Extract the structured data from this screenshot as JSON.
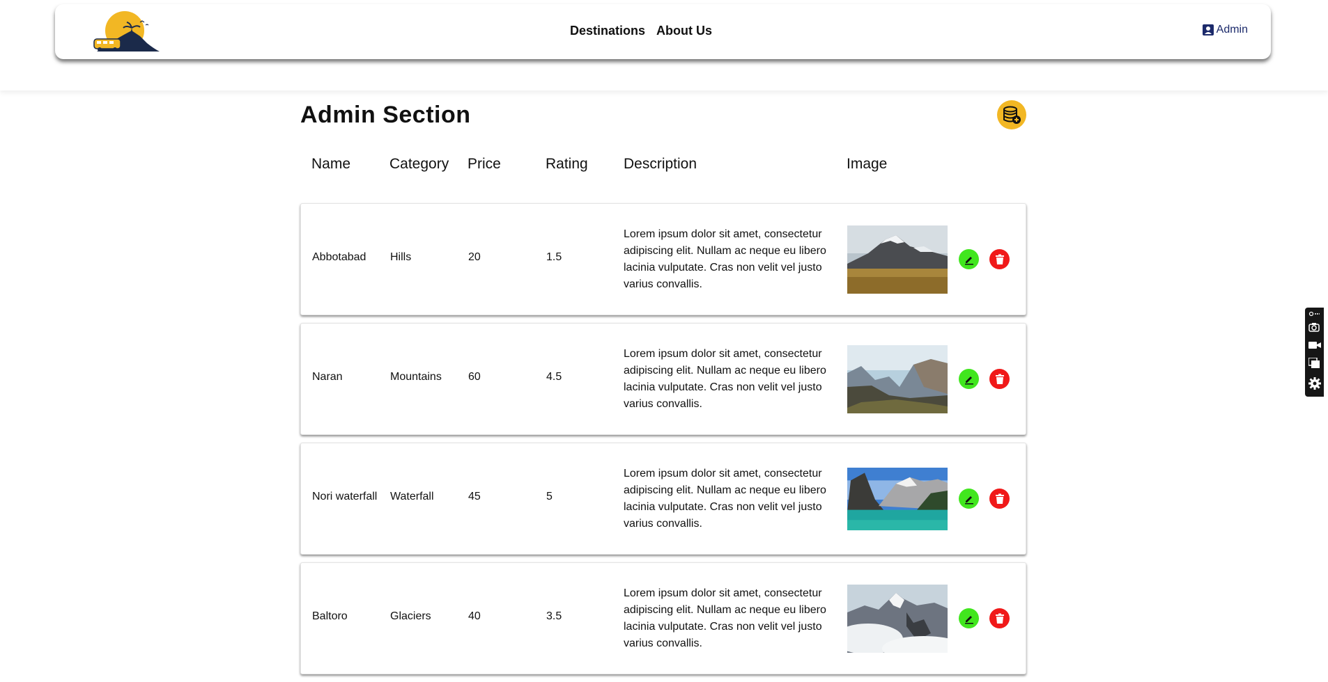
{
  "nav": {
    "links": [
      "Destinations",
      "About Us"
    ],
    "admin_label": "Admin"
  },
  "page": {
    "title": "Admin Section"
  },
  "table": {
    "headers": [
      "Name",
      "Category",
      "Price",
      "Rating",
      "Description",
      "Image"
    ],
    "rows": [
      {
        "name": "Abbotabad",
        "category": "Hills",
        "price": "20",
        "rating": "1.5",
        "description": "Lorem ipsum dolor sit amet, consectetur adipiscing elit. Nullam ac neque eu libero lacinia vulputate. Cras non velit vel justo varius convallis.",
        "image": "snowy-mountain-plain"
      },
      {
        "name": "Naran",
        "category": "Mountains",
        "price": "60",
        "rating": "4.5",
        "description": "Lorem ipsum dolor sit amet, consectetur adipiscing elit. Nullam ac neque eu libero lacinia vulputate. Cras non velit vel justo varius convallis.",
        "image": "mountain-valley"
      },
      {
        "name": "Nori waterfall",
        "category": "Waterfall",
        "price": "45",
        "rating": "5",
        "description": "Lorem ipsum dolor sit amet, consectetur adipiscing elit. Nullam ac neque eu libero lacinia vulputate. Cras non velit vel justo varius convallis.",
        "image": "mountain-lake"
      },
      {
        "name": "Baltoro",
        "category": "Glaciers",
        "price": "40",
        "rating": "3.5",
        "description": "Lorem ipsum dolor sit amet, consectetur adipiscing elit. Nullam ac neque eu libero lacinia vulputate. Cras non velit vel justo varius convallis.",
        "image": "snowy-peaks-clouds"
      }
    ]
  },
  "icons": {
    "admin": "user-square-icon",
    "add_db": "database-add-icon",
    "edit": "pencil-icon",
    "delete": "trash-icon"
  },
  "colors": {
    "accent_yellow": "#f2b724",
    "edit_green": "#41e61e",
    "delete_red": "#f01919",
    "admin_blue": "#1c2a6b"
  }
}
